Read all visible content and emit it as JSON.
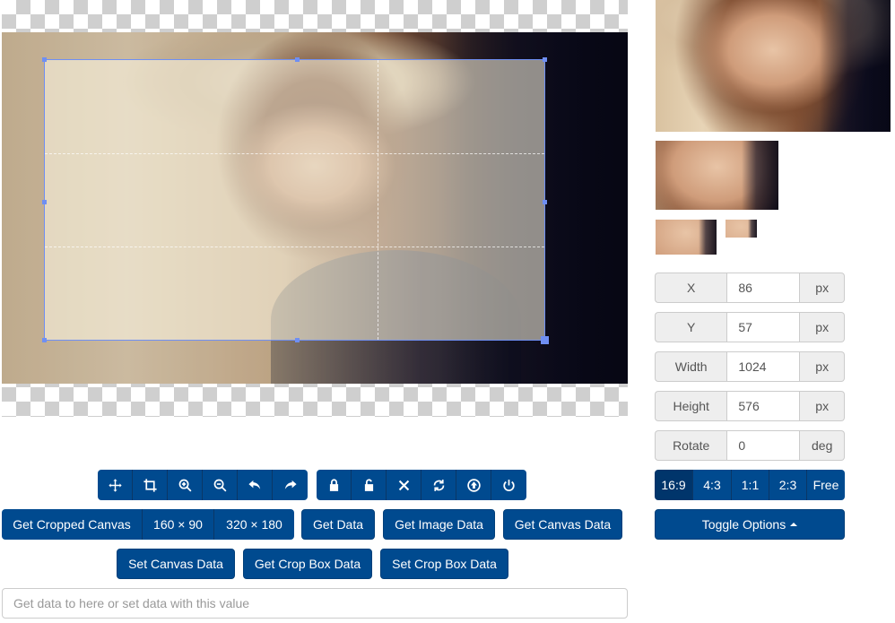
{
  "data_panel": {
    "x": {
      "label": "X",
      "value": "86",
      "unit": "px"
    },
    "y": {
      "label": "Y",
      "value": "57",
      "unit": "px"
    },
    "width": {
      "label": "Width",
      "value": "1024",
      "unit": "px"
    },
    "height": {
      "label": "Height",
      "value": "576",
      "unit": "px"
    },
    "rotate": {
      "label": "Rotate",
      "value": "0",
      "unit": "deg"
    }
  },
  "aspect_ratios": {
    "r169": "16:9",
    "r43": "4:3",
    "r11": "1:1",
    "r23": "2:3",
    "free": "Free"
  },
  "toggle_options": "Toggle Options",
  "toolbar_icons": [
    "move-icon",
    "crop-icon",
    "zoom-in-icon",
    "zoom-out-icon",
    "rotate-left-icon",
    "rotate-right-icon",
    "lock-icon",
    "unlock-icon",
    "clear-icon",
    "reset-icon",
    "upload-icon",
    "destroy-icon"
  ],
  "method_buttons": {
    "get_cropped_canvas": "Get Cropped Canvas",
    "size_160": "160 × 90",
    "size_320": "320 × 180",
    "get_data": "Get Data",
    "get_image_data": "Get Image Data",
    "get_canvas_data": "Get Canvas Data",
    "set_canvas_data": "Set Canvas Data",
    "get_crop_box_data": "Get Crop Box Data",
    "set_crop_box_data": "Set Crop Box Data"
  },
  "data_field": {
    "placeholder": "Get data to here or set data with this value",
    "value": ""
  },
  "colors": {
    "primary": "#004a8f",
    "crop_line": "#6f8ff3"
  }
}
